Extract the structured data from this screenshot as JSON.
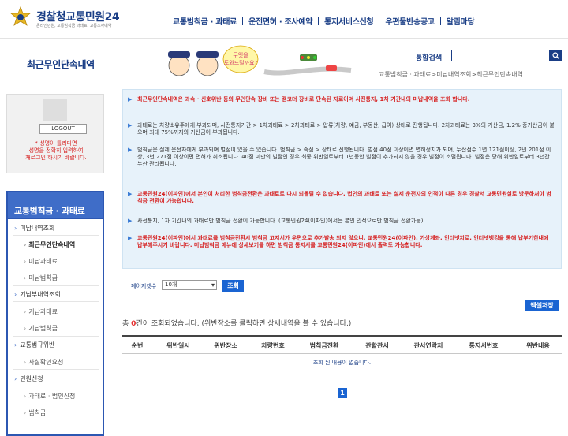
{
  "header": {
    "logo_title_a": "경찰청",
    "logo_title_b": "교통민원24",
    "logo_tagline": "온라인민원, 교통범칙금 과태료, 교통조사예약",
    "gnb": [
      "교통범칙금 · 과태료",
      "운전면허 · 조사예약",
      "통지서비스신청",
      "우편물반송공고",
      "알림마당"
    ]
  },
  "subtop": {
    "heading": "최근무인단속내역",
    "mascot_bubble": "무엇을 도와드릴까요?",
    "search_label": "통합검색",
    "search_value": "",
    "breadcrumb": "교통범칙금 · 과태료>미납내역조회>최근무인단속내역"
  },
  "login": {
    "logout_label": "LOGOUT",
    "warning": "* 성명이 틀리다면\n성명을 정확히 입력하여\n재로그인 하시기 바랍니다."
  },
  "lnb": {
    "title": "교통범칙금 · 과태료",
    "items": [
      {
        "label": "미납내역조회",
        "level": 1
      },
      {
        "label": "최근무인단속내역",
        "level": 2,
        "active": true
      },
      {
        "label": "미납과태료",
        "level": 2
      },
      {
        "label": "미납범칙금",
        "level": 2
      },
      {
        "label": "기납부내역조회",
        "level": 1
      },
      {
        "label": "기납과태료",
        "level": 2
      },
      {
        "label": "기납범칙금",
        "level": 2
      },
      {
        "label": "교통법규위반",
        "level": 1
      },
      {
        "label": "사실확인요청",
        "level": 2
      },
      {
        "label": "민원신청",
        "level": 1
      },
      {
        "label": "과태료 · 범인신청",
        "level": 2
      },
      {
        "label": "범칙금",
        "level": 2
      }
    ]
  },
  "notice": [
    {
      "style": "red",
      "text": "최근무인단속내역은 과속 · 신호위반 등의 무인단속 장비 또는 캠코더 장비로 단속된 자료이며 사전통지, 1차 기간내의 미납내역을 조회 합니다."
    },
    {
      "style": "normal",
      "text": "과태료는 차량소유주에게 부과되며, 사전통지기간 > 1차과태료 > 2차과태료 > 압류(차량, 예금, 부동산, 급여) 상태로 진행됩니다. 2차과태료는 3%의 가산금, 1.2% 중가산금이 붙으며 최대 75%까지의 가산금이 부과됩니다."
    },
    {
      "style": "normal",
      "text": "범칙금은 실제 운전자에게 부과되며 벌점이 있을 수 있습니다. 범칙금 > 즉심 > 상태로 진행됩니다. 벌점 40점 이상이면 면허정지가 되며, 누산점수 1년 121점이상, 2년 201점 이상, 3년 271점 이상이면 면허가 취소됩니다. 40점 미만의 벌점인 경우 최종 위반일로부터 1년동안 벌점이 추가되지 않을 경우 벌점이 소멸됩니다. 벌점은 당해 위반일로부터 3년간 누산 관리됩니다."
    },
    {
      "style": "red",
      "text": "교통민원24(이파인)에서 본인이 처리한 범칙금전환은 과태료로 다시 되돌릴 수 없습니다. 법인의 과태료 또는 실제 운전자의 인적이 다른 경우 경찰서 교통민원실로 방문하셔야 범칙금 전환이 가능합니다."
    },
    {
      "style": "normal",
      "text": "사전통지, 1차 기간내의 과태료만 범칙금 전환이 가능합니다. (교통민원24(이파인)에서는 본인 인적으로만 범칙금 전환가능)"
    },
    {
      "style": "red",
      "text": "교통민원24(이파인)에서 과태료를 범칙금전환시 범칙금 고지서가 우편으로 추가발송 되지 않으니, 교통민원24(이파인), 가상계좌, 인터넷지로, 인터넷뱅킹을 통해 납부기한내에 납부해주시기 바랍니다. 미납범칙금 메뉴에 상세보기를 하면 범칙금 통지서를 교통민원24(이파인)에서 출력도 가능합니다."
    }
  ],
  "controls": {
    "pagesize_label": "페이지갯수",
    "pagesize_value": "10개",
    "query_label": "조회",
    "excel_label": "엑셀저장",
    "result_prefix": "총 ",
    "result_count": "0",
    "result_suffix": "건이 조회되었습니다. (위반장소를 클릭하면 상세내역을 볼 수 있습니다.)"
  },
  "table": {
    "columns": [
      "순번",
      "위반일시",
      "위반장소",
      "차량번호",
      "범칙금전환",
      "관할관서",
      "관서연락처",
      "통지서번호",
      "위반내용"
    ],
    "empty_text": "조회 된 내용이 없습니다."
  },
  "pager": {
    "current": "1"
  },
  "colors": {
    "brand": "#1a3e86",
    "accent": "#1a64d2",
    "warn": "#d62020",
    "notice_bg": "#e7f2fa"
  },
  "icons": [
    "police-emblem-icon",
    "search-icon",
    "mascot-illustration"
  ]
}
